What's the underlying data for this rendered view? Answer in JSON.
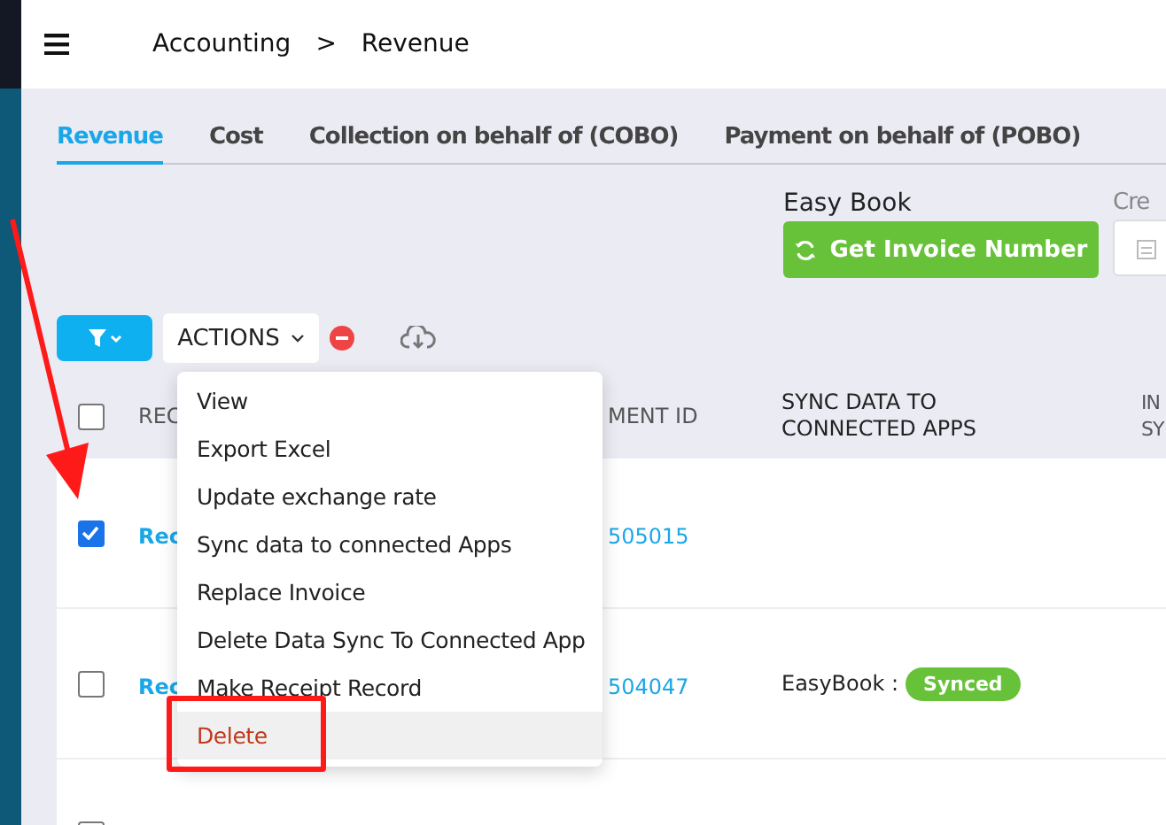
{
  "breadcrumb": [
    "Accounting",
    ">",
    "Revenue"
  ],
  "tabs": [
    {
      "label": "Revenue",
      "selected": true
    },
    {
      "label": "Cost",
      "selected": false
    },
    {
      "label": "Collection on behalf of (COBO)",
      "selected": false
    },
    {
      "label": "Payment on behalf of (POBO)",
      "selected": false
    }
  ],
  "easy_book": {
    "label": "Easy Book",
    "button": "Get Invoice Number"
  },
  "column_cut_label": "Cre",
  "toolbar": {
    "actions": "ACTIONS"
  },
  "table": {
    "header_checked": false,
    "columns": [
      "REC",
      "MENT ID",
      "SYNC DATA TO CONNECTED APPS",
      "IN SY"
    ],
    "rows": [
      {
        "checked": true,
        "record": "Rec",
        "payment_id": "505015"
      },
      {
        "checked": false,
        "record": "Rec",
        "payment_id": "504047",
        "sync_app": "EasyBook :",
        "sync_status": "Synced"
      },
      {
        "checked": false
      }
    ]
  },
  "actions_menu": [
    {
      "label": "View",
      "kind": "normal",
      "highlighted": false
    },
    {
      "label": "Export Excel",
      "kind": "normal",
      "highlighted": false
    },
    {
      "label": "Update exchange rate",
      "kind": "normal",
      "highlighted": false
    },
    {
      "label": "Sync data to connected Apps",
      "kind": "normal",
      "highlighted": false
    },
    {
      "label": "Replace Invoice",
      "kind": "normal",
      "highlighted": false
    },
    {
      "label": "Delete Data Sync To Connected App",
      "kind": "normal",
      "highlighted": false
    },
    {
      "label": "Make Receipt Record",
      "kind": "normal",
      "highlighted": false
    },
    {
      "label": "Delete",
      "kind": "danger",
      "highlighted": true
    }
  ]
}
